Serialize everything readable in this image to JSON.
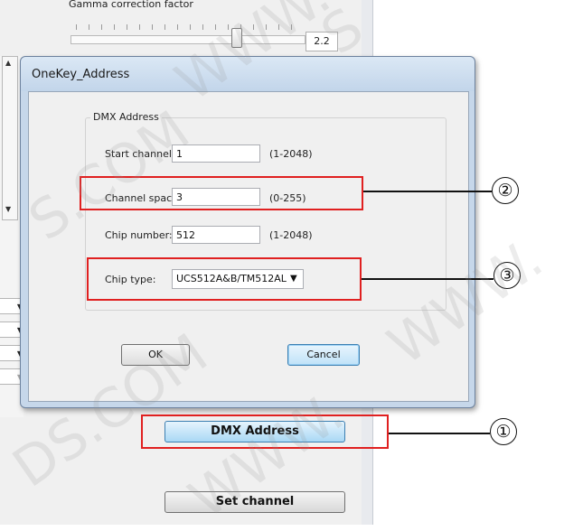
{
  "background_app": {
    "gamma_label": "Gamma correction factor",
    "gamma_value": "2.2",
    "dmx_address_button": "DMX Address",
    "set_channel_button": "Set channel"
  },
  "dialog": {
    "title": "OneKey_Address",
    "group_title": "DMX Address",
    "start_channel": {
      "label": "Start channel:",
      "value": "1",
      "range": "(1-2048)"
    },
    "channel_space": {
      "label": "Channel space:",
      "value": "3",
      "range": "(0-255)"
    },
    "chip_number": {
      "label": "Chip number:",
      "value": "512",
      "range": "(1-2048)"
    },
    "chip_type": {
      "label": "Chip type:",
      "value": "UCS512A&B/TM512AL",
      "arrow": "▼"
    },
    "ok_label": "OK",
    "cancel_label": "Cancel"
  },
  "annotations": {
    "marker_1": "①",
    "marker_2": "②",
    "marker_3": "③",
    "highlight_color": "#e02020"
  },
  "watermark": {
    "text_1": "WWW.",
    "text_2": "S.COM",
    "text_3": "WWW.",
    "text_4": "DS.COM",
    "text_5": "WWW.",
    "text_6": "S"
  },
  "colors": {
    "dialog_frame": "#c6d7ea",
    "active_button": "#a9d8f5"
  }
}
